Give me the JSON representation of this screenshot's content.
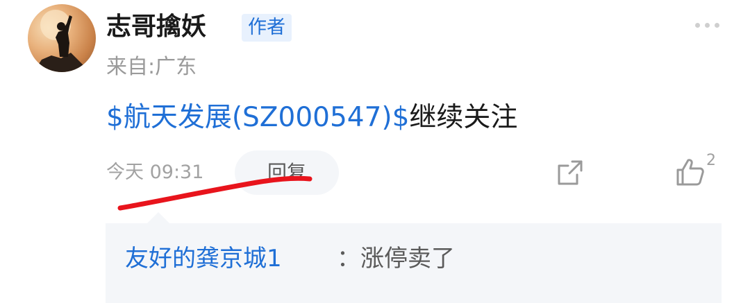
{
  "comment": {
    "username": "志哥擒妖",
    "badge": "作者",
    "location": "来自:广东",
    "content": {
      "stock_link": "$航天发展(SZ000547)$",
      "text": "继续关注"
    },
    "timestamp": "今天 09:31",
    "reply_label": "回复",
    "like_count": "2",
    "icons": {
      "more": "more-dots-icon",
      "share": "share-icon",
      "like": "thumbs-up-icon"
    },
    "annotation_color": "#e8141c"
  },
  "reply": {
    "author": "友好的龚京城1",
    "separator": "：",
    "text": "涨停卖了"
  },
  "colors": {
    "link": "#1f6fd6",
    "badge_bg": "#e8f1fd",
    "reply_bg": "#f4f6f9",
    "muted_text": "#9a9a9a"
  }
}
